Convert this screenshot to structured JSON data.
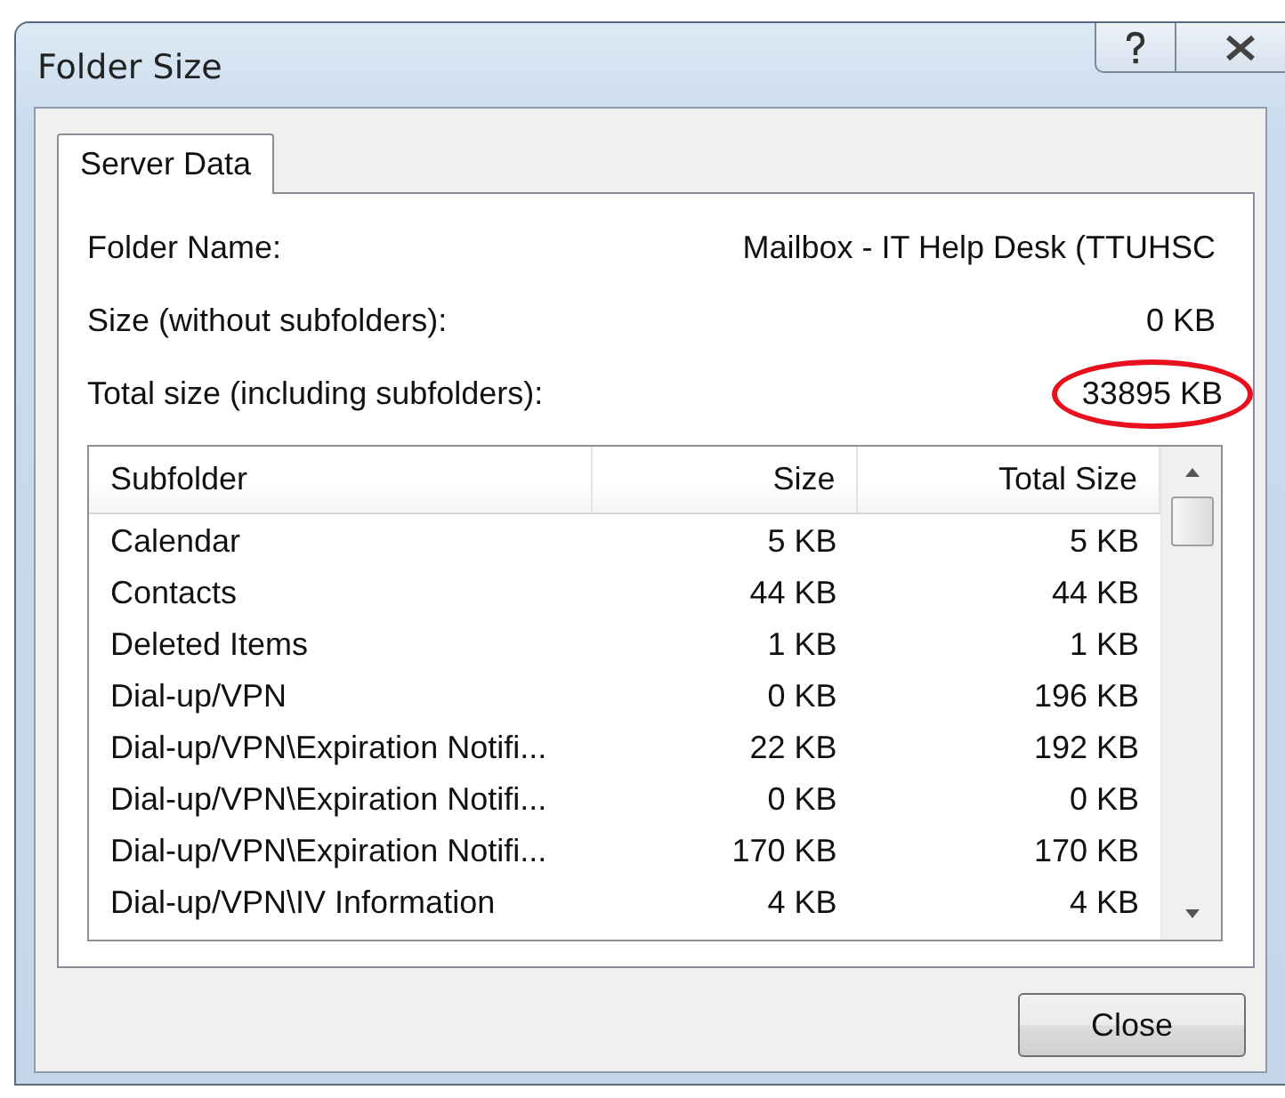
{
  "window": {
    "title": "Folder Size"
  },
  "tabs": [
    {
      "label": "Server Data",
      "selected": true
    }
  ],
  "fields": [
    {
      "label": "Folder Name:",
      "value": "Mailbox - IT Help Desk (TTUHSC",
      "circled": false
    },
    {
      "label": "Size (without subfolders):",
      "value": "0 KB",
      "circled": false
    },
    {
      "label": "Total size (including subfolders):",
      "value": "33895 KB",
      "circled": true
    }
  ],
  "table": {
    "columns": [
      "Subfolder",
      "Size",
      "Total Size"
    ],
    "rows": [
      [
        "Calendar",
        "5 KB",
        "5 KB"
      ],
      [
        "Contacts",
        "44 KB",
        "44 KB"
      ],
      [
        "Deleted Items",
        "1 KB",
        "1 KB"
      ],
      [
        "Dial-up/VPN",
        "0 KB",
        "196 KB"
      ],
      [
        "Dial-up/VPN\\Expiration Notifi...",
        "22 KB",
        "192 KB"
      ],
      [
        "Dial-up/VPN\\Expiration Notifi...",
        "0 KB",
        "0 KB"
      ],
      [
        "Dial-up/VPN\\Expiration Notifi...",
        "170 KB",
        "170 KB"
      ],
      [
        "Dial-up/VPN\\IV Information",
        "4 KB",
        "4 KB"
      ]
    ]
  },
  "buttons": [
    "Close"
  ]
}
